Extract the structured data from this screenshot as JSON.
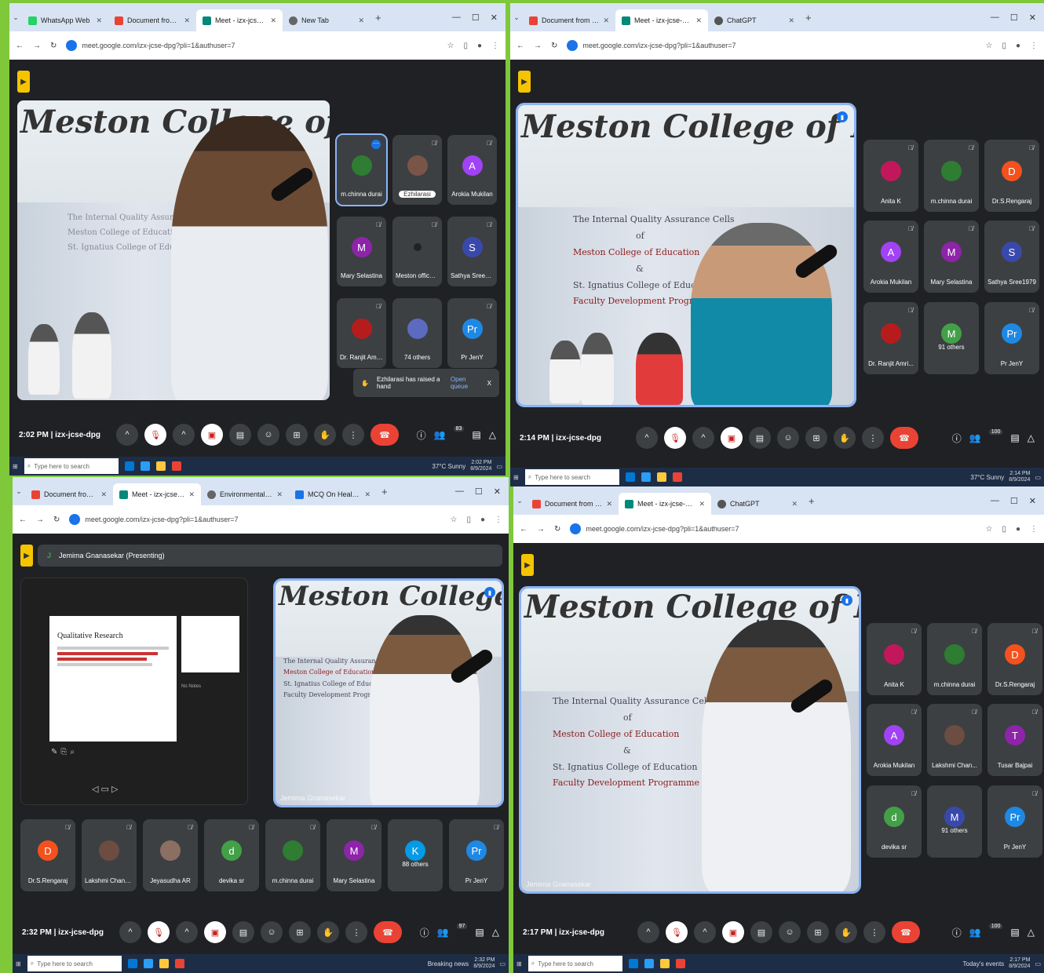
{
  "meeting_code": "izx-jcse-dpg",
  "url": "meet.google.com/izx-jcse-dpg?pli=1&authuser=7",
  "banner_title": "Meston College of Education",
  "w1": {
    "tabs": [
      "WhatsApp Web",
      "Document from Jenifer Das -",
      "Meet - izx-jcse-dpg",
      "New Tab"
    ],
    "time": "2:02 PM",
    "people_badge": "83",
    "tiles": [
      {
        "name": "m.chinna durai",
        "av": "",
        "color": "#2e7d32"
      },
      {
        "name": "Ezhilarasi",
        "av": "",
        "color": "#795548"
      },
      {
        "name": "Arokia Mukilan",
        "av": "A",
        "color": "#a142f4"
      },
      {
        "name": "Mary Selastina",
        "av": "M",
        "color": "#8e24aa"
      },
      {
        "name": "Meston office ...",
        "av": "",
        "color": "#222"
      },
      {
        "name": "Sathya Sree1979",
        "av": "S",
        "color": "#3949ab"
      },
      {
        "name": "Dr. Ranjit Amri...",
        "av": "",
        "color": "#b71c1c"
      },
      {
        "name": "74 others",
        "av": "",
        "color": "#5c6bc0"
      },
      {
        "name": "Pr JenY",
        "av": "Pr",
        "color": "#1e88e5"
      }
    ],
    "toast": "Ezhilarasi has raised a hand",
    "toast_link": "Open queue",
    "toast_close": "X",
    "taskbar": {
      "search": "Type here to search",
      "weather": "37°C Sunny",
      "clock": "2:02 PM",
      "date": "8/9/2024"
    }
  },
  "w2": {
    "tabs": [
      "Document from Jenifer Das -",
      "Meet - izx-jcse-dpg",
      "ChatGPT"
    ],
    "time": "2:14 PM",
    "people_badge": "100",
    "tiles": [
      {
        "name": "Anita K",
        "av": "",
        "color": "#c2185b"
      },
      {
        "name": "m.chinna durai",
        "av": "",
        "color": "#2e7d32"
      },
      {
        "name": "Dr.S.Rengaraj",
        "av": "D",
        "color": "#f4511e"
      },
      {
        "name": "Arokia Mukilan",
        "av": "A",
        "color": "#a142f4"
      },
      {
        "name": "Mary Selastina",
        "av": "M",
        "color": "#8e24aa"
      },
      {
        "name": "Sathya Sree1979",
        "av": "S",
        "color": "#3949ab"
      },
      {
        "name": "Dr. Ranjit Amri...",
        "av": "",
        "color": "#b71c1c"
      },
      {
        "name": "91 others",
        "av": "M",
        "color": "#43a047"
      },
      {
        "name": "Pr JenY",
        "av": "Pr",
        "color": "#1e88e5"
      }
    ],
    "taskbar": {
      "search": "Type here to search",
      "weather": "37°C Sunny",
      "clock": "2:14 PM",
      "date": "8/9/2024"
    }
  },
  "w3": {
    "tabs": [
      "Document from Jenifer Das -",
      "Meet - izx-jcse-dpg",
      "Environmental Sustainability C",
      "MCQ On Health And Hygiene"
    ],
    "presenting": "Jemima Gnanasekar (Presenting)",
    "presenter_initial": "J",
    "slide_title": "Qualitative Research",
    "slide_notes": "No Notes",
    "caption": "Jemima Gnanasekar",
    "time": "2:32 PM",
    "people_badge": "97",
    "tiles": [
      {
        "name": "Dr.S.Rengaraj",
        "av": "D",
        "color": "#f4511e"
      },
      {
        "name": "Lakshmi Chandar",
        "av": "",
        "color": "#6d4c41"
      },
      {
        "name": "Jeyasudha AR",
        "av": "",
        "color": "#8d6e63"
      },
      {
        "name": "devika sr",
        "av": "d",
        "color": "#43a047"
      },
      {
        "name": "m.chinna durai",
        "av": "",
        "color": "#2e7d32"
      },
      {
        "name": "Mary Selastina",
        "av": "M",
        "color": "#8e24aa"
      },
      {
        "name": "88 others",
        "av": "K",
        "color": "#039be5"
      },
      {
        "name": "Pr JenY",
        "av": "Pr",
        "color": "#1e88e5"
      }
    ],
    "taskbar": {
      "search": "Type here to search",
      "news": "Breaking news",
      "clock": "2:32 PM",
      "date": "8/9/2024"
    }
  },
  "w4": {
    "tabs": [
      "Document from Jenifer Das -",
      "Meet - izx-jcse-dpg",
      "ChatGPT"
    ],
    "caption": "Jemima Gnanasekar",
    "time": "2:17 PM",
    "people_badge": "100",
    "tiles": [
      {
        "name": "Anita K",
        "av": "",
        "color": "#c2185b"
      },
      {
        "name": "m.chinna durai",
        "av": "",
        "color": "#2e7d32"
      },
      {
        "name": "Dr.S.Rengaraj",
        "av": "D",
        "color": "#f4511e"
      },
      {
        "name": "Arokia Mukilan",
        "av": "A",
        "color": "#a142f4"
      },
      {
        "name": "Lakshmi Chan...",
        "av": "",
        "color": "#6d4c41"
      },
      {
        "name": "Tusar Bajpai",
        "av": "T",
        "color": "#8e24aa"
      },
      {
        "name": "devika sr",
        "av": "d",
        "color": "#43a047"
      },
      {
        "name": "91 others",
        "av": "M",
        "color": "#3949ab"
      },
      {
        "name": "Pr JenY",
        "av": "Pr",
        "color": "#1e88e5"
      }
    ],
    "taskbar": {
      "search": "Type here to search",
      "events": "Today's events",
      "clock": "2:17 PM",
      "date": "8/9/2024"
    }
  },
  "board_lines": [
    "The Internal Quality Assurance Cells",
    "of",
    "Meston College of Education",
    "&",
    "St. Ignatius College of Education",
    "Faculty Development Programme"
  ]
}
